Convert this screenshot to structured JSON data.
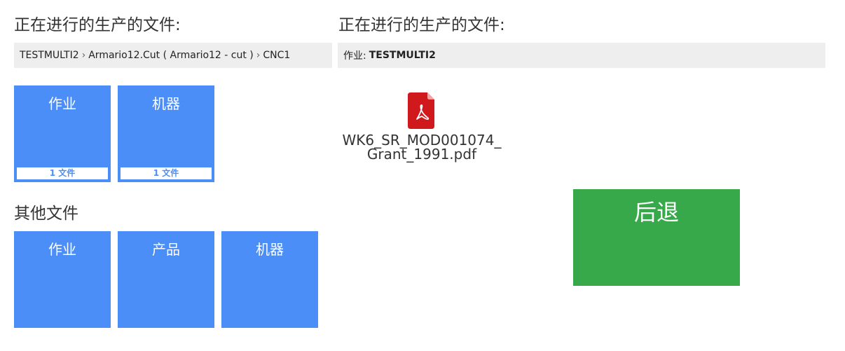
{
  "left_panel": {
    "title": "正在进行的生产的文件:",
    "breadcrumb": [
      "TESTMULTI2",
      "Armario12.Cut ( Armario12 - cut )",
      "CNC1"
    ],
    "breadcrumb_separator": "›",
    "tiles": [
      {
        "label": "作业",
        "count": "1 文件"
      },
      {
        "label": "机器",
        "count": "1 文件"
      }
    ]
  },
  "other_files": {
    "title": "其他文件",
    "tiles": [
      {
        "label": "作业"
      },
      {
        "label": "产品"
      },
      {
        "label": "机器"
      }
    ]
  },
  "right_panel": {
    "title": "正在进行的生产的文件:",
    "job_label": "作业:",
    "job_value": "TESTMULTI2",
    "files": [
      {
        "name": "WK6_SR_MOD001074_Grant_1991.pdf",
        "icon": "pdf-file-icon"
      }
    ]
  },
  "back_button": {
    "label": "后退"
  },
  "colors": {
    "tile_blue": "#4b8ef8",
    "back_green": "#38a94a",
    "bar_gray": "#eeeeee",
    "pdf_red": "#d0191c"
  }
}
